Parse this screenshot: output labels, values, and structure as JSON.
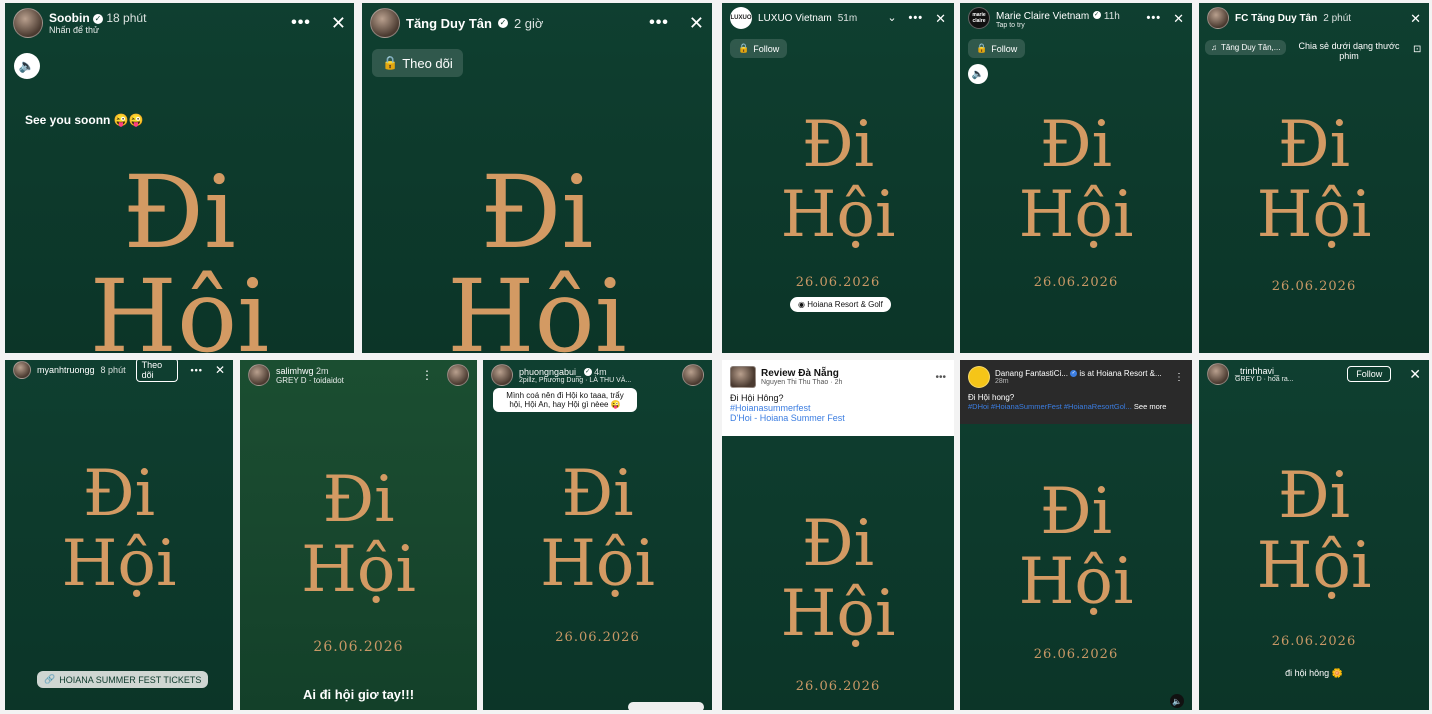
{
  "event": {
    "line1": "Đi",
    "line2": "Hội",
    "date": "26.06.2026"
  },
  "panels": {
    "soobin": {
      "name": "Soobin",
      "time": "18 phút",
      "sub": "Nhấn để thử",
      "caption": "See you soonn 😜😜"
    },
    "tan": {
      "name": "Tăng Duy Tân",
      "time": "2 giờ",
      "follow": "Theo dõi"
    },
    "luxuo": {
      "logo": "LUXUO",
      "name": "LUXUO Vietnam",
      "time": "51m",
      "follow": "Follow",
      "location": "Hoiana Resort & Golf"
    },
    "marie": {
      "logo": "marie claire",
      "name": "Marie Claire Vietnam",
      "time": "11h",
      "sub": "Tap to try",
      "follow": "Follow"
    },
    "fctan": {
      "name": "FC Tăng Duy Tân",
      "time": "2 phút",
      "music": "Tăng Duy Tân,...",
      "share": "Chia sẻ dưới dạng thước phim"
    },
    "myanh": {
      "name": "myanhtruongg",
      "time": "8 phút",
      "follow": "Theo dõi",
      "link": "HOIANA SUMMER FEST TICKETS"
    },
    "salim": {
      "name": "salimhwg",
      "time": "2m",
      "music": "GREY D · toidaidot",
      "caption": "Ai đi hội giơ tay!!!"
    },
    "phuong": {
      "name": "phuongngabui_",
      "time": "4m",
      "music": "2pillz, Phương Dung · LÀ THU VÀ...",
      "sticker": "Mình coá nên đi Hội ko taaa, trẩy hội, Hội An, hay Hội gì nèee 😜"
    },
    "review": {
      "name": "Review Đà Nẵng",
      "author": "Nguyen Thi Thu Thao",
      "time": "2h",
      "text": "Đi Hội Hông?",
      "tag": "#Hoianasummerfest",
      "link": "D'Hoi - Hoiana Summer Fest"
    },
    "danang": {
      "name": "Danang FantastiCi...",
      "at": "is at Hoiana Resort &...",
      "time": "28m",
      "text": "Đi Hội hong?",
      "tags": "#DHoi #HoianaSummerFest #HoianaResortGol...",
      "more": "See more"
    },
    "trinh": {
      "name": "_trinhhavi_",
      "music": "GREY D · hoả ra...",
      "follow": "Follow",
      "caption": "đi hội hông 🌼"
    }
  }
}
